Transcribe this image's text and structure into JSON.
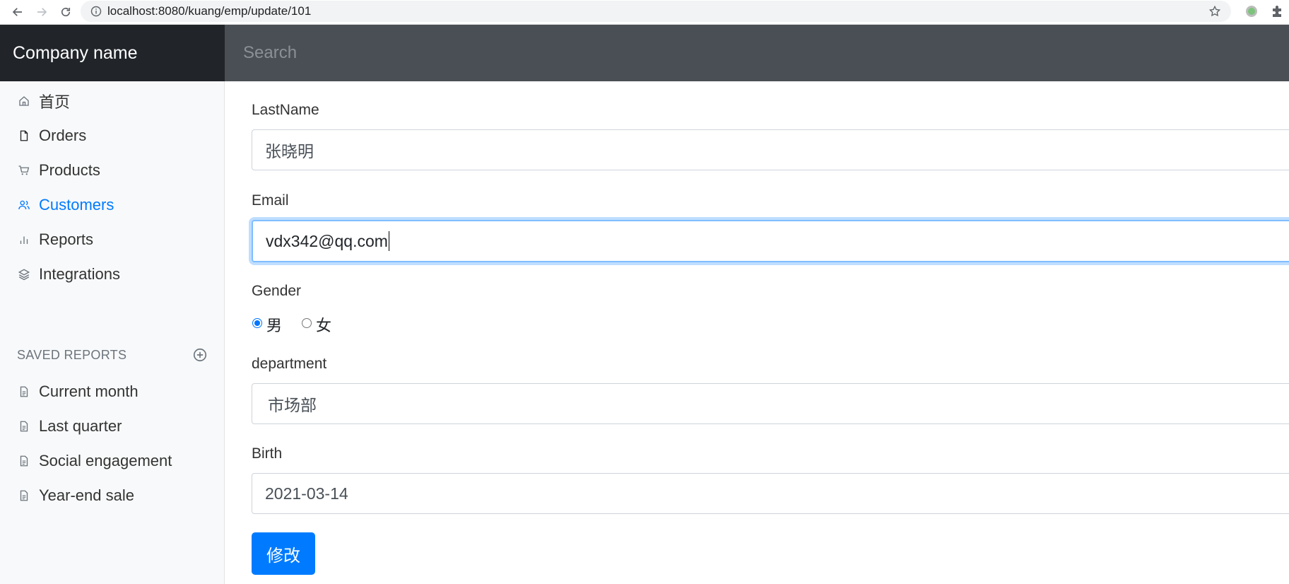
{
  "browser": {
    "url": "localhost:8080/kuang/emp/update/101"
  },
  "navbar": {
    "brand": "Company name",
    "search_placeholder": "Search"
  },
  "sidebar": {
    "items": [
      {
        "label": "首页",
        "icon": "home-icon",
        "active": false
      },
      {
        "label": "Orders",
        "icon": "file-icon",
        "active": false
      },
      {
        "label": "Products",
        "icon": "shopping-cart-icon",
        "active": false
      },
      {
        "label": "Customers",
        "icon": "users-icon",
        "active": true
      },
      {
        "label": "Reports",
        "icon": "bar-chart-icon",
        "active": false
      },
      {
        "label": "Integrations",
        "icon": "layers-icon",
        "active": false
      }
    ],
    "saved_heading": "SAVED REPORTS",
    "saved_items": [
      {
        "label": "Current month",
        "icon": "file-text-icon"
      },
      {
        "label": "Last quarter",
        "icon": "file-text-icon"
      },
      {
        "label": "Social engagement",
        "icon": "file-text-icon"
      },
      {
        "label": "Year-end sale",
        "icon": "file-text-icon"
      }
    ]
  },
  "form": {
    "lastname_label": "LastName",
    "lastname_value": "张晓明",
    "email_label": "Email",
    "email_value": "vdx342@qq.com",
    "gender_label": "Gender",
    "gender_options": [
      "男",
      "女"
    ],
    "gender_selected": "男",
    "department_label": "department",
    "department_value": "市场部",
    "birth_label": "Birth",
    "birth_value": "2021-03-14",
    "submit_label": "修改"
  },
  "colors": {
    "accent": "#007bff",
    "navbar_dark": "#212529",
    "search_bg": "#4a4f55"
  }
}
